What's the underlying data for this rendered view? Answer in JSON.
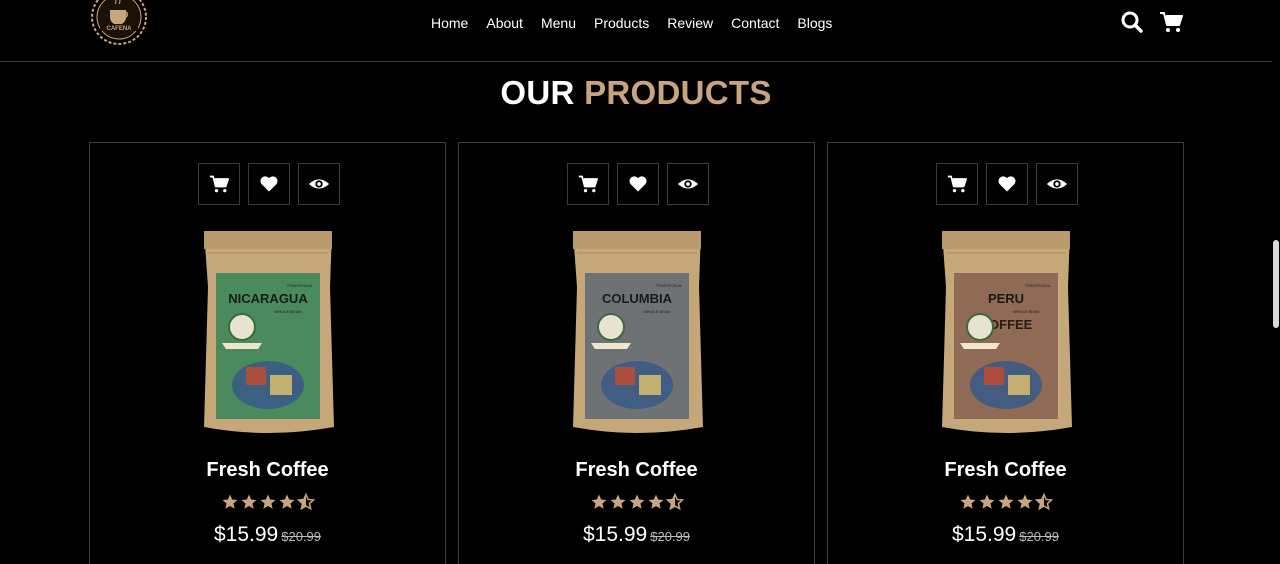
{
  "header": {
    "logo_text": "CAFENA",
    "nav": [
      "Home",
      "About",
      "Menu",
      "Products",
      "Review",
      "Contact",
      "Blogs"
    ],
    "icons": [
      "search-icon",
      "cart-icon"
    ]
  },
  "section": {
    "title_white": "OUR",
    "title_accent": "PRODUCTS"
  },
  "colors": {
    "accent": "#c9a47e",
    "background": "#000000",
    "border": "#3d3d3d"
  },
  "products": [
    {
      "name": "Fresh Coffee",
      "price": "$15.99",
      "old_price": "$20.99",
      "rating": 4.5,
      "bag_label": "NICARAGUA",
      "bag_sub": "WHOLE BEAN",
      "bag_tag": "TRADITIONAL",
      "bag_color": "#4a8a5c",
      "actions": [
        "cart-icon",
        "heart-icon",
        "eye-icon"
      ]
    },
    {
      "name": "Fresh Coffee",
      "price": "$15.99",
      "old_price": "$20.99",
      "rating": 4.5,
      "bag_label": "COLUMBIA",
      "bag_sub": "WHOLE BEAN",
      "bag_tag": "TRADITIONAL",
      "bag_color": "#6f7275",
      "actions": [
        "cart-icon",
        "heart-icon",
        "eye-icon"
      ]
    },
    {
      "name": "Fresh Coffee",
      "price": "$15.99",
      "old_price": "$20.99",
      "rating": 4.5,
      "bag_label": "PERU",
      "bag_sub": "WHOLE BEAN",
      "bag_tag": "TRADITIONAL",
      "bag_word": "COFFEE",
      "bag_color": "#8f6a55",
      "actions": [
        "cart-icon",
        "heart-icon",
        "eye-icon"
      ]
    }
  ]
}
